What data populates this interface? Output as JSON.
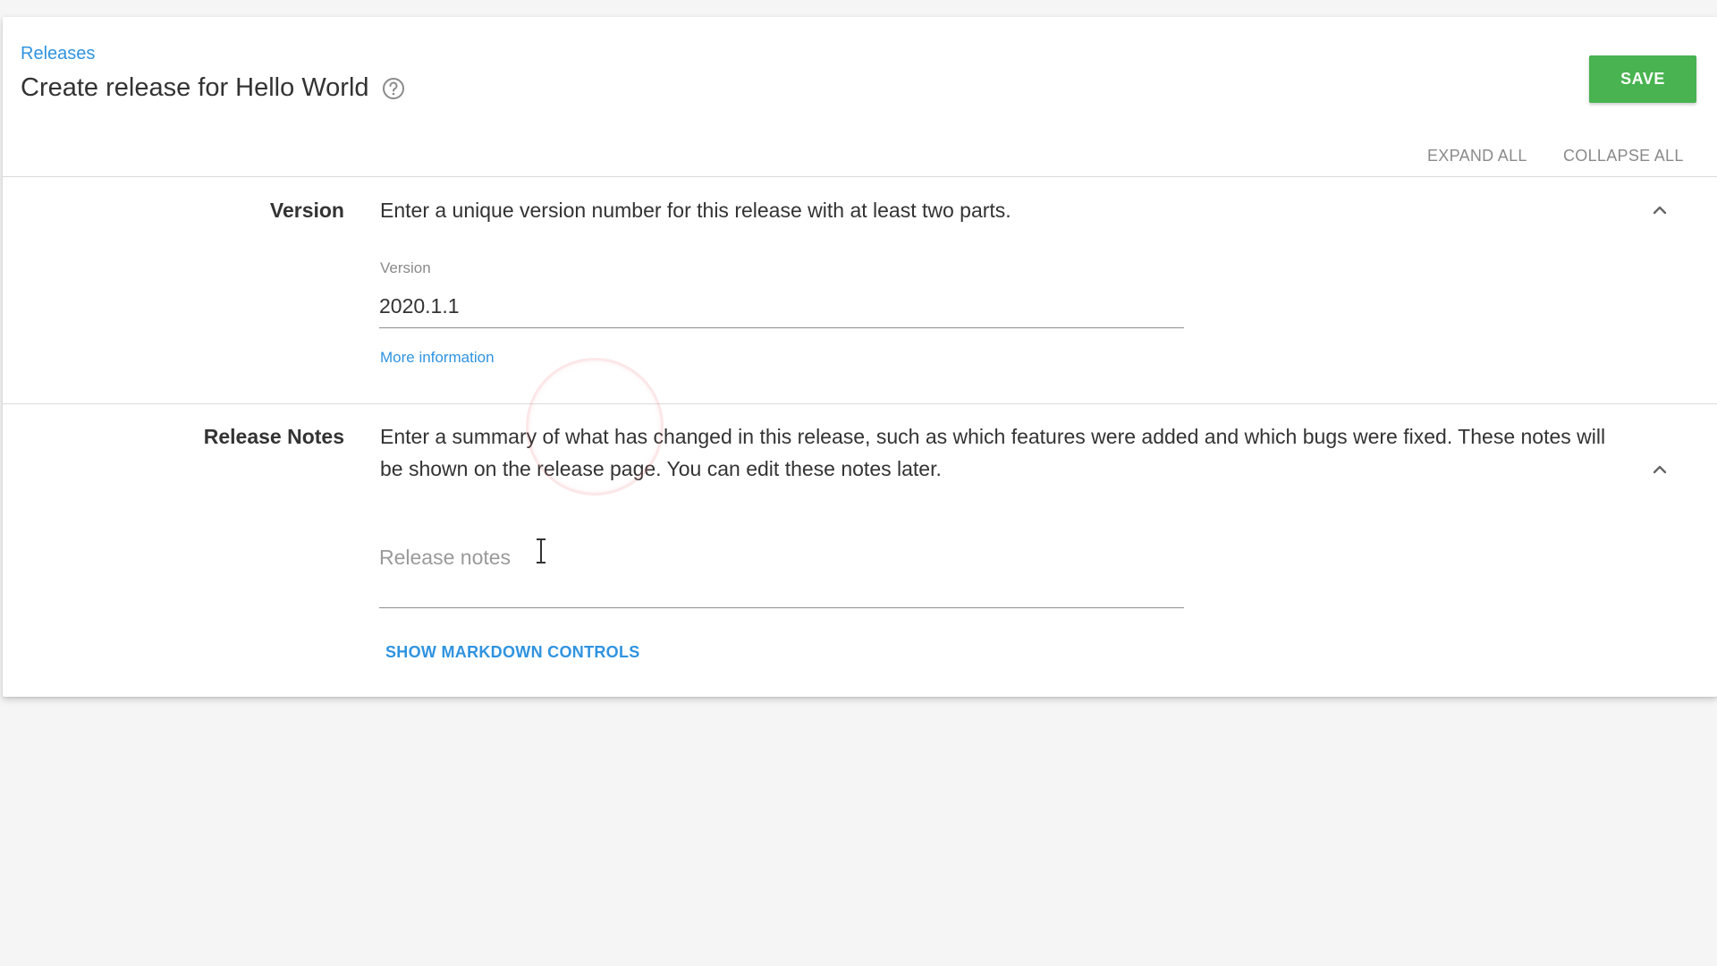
{
  "header": {
    "breadcrumb": "Releases",
    "title": "Create release for Hello World",
    "save_label": "SAVE"
  },
  "toolbar": {
    "expand_all": "EXPAND ALL",
    "collapse_all": "COLLAPSE ALL"
  },
  "sections": {
    "version": {
      "label": "Version",
      "description": "Enter a unique version number for this release with at least two parts.",
      "field_label": "Version",
      "value": "2020.1.1",
      "more_info": "More information"
    },
    "release_notes": {
      "label": "Release Notes",
      "description": "Enter a summary of what has changed in this release, such as which features were added and which bugs were fixed. These notes will be shown on the release page. You can edit these notes later.",
      "placeholder": "Release notes",
      "markdown_toggle": "SHOW MARKDOWN CONTROLS"
    }
  },
  "icons": {
    "help": "help-circle-icon",
    "collapse": "chevron-up-icon",
    "cursor": "text-cursor-icon"
  },
  "colors": {
    "link": "#2f93e0",
    "save_button": "#48b350",
    "muted_text": "#8a8a8a"
  }
}
